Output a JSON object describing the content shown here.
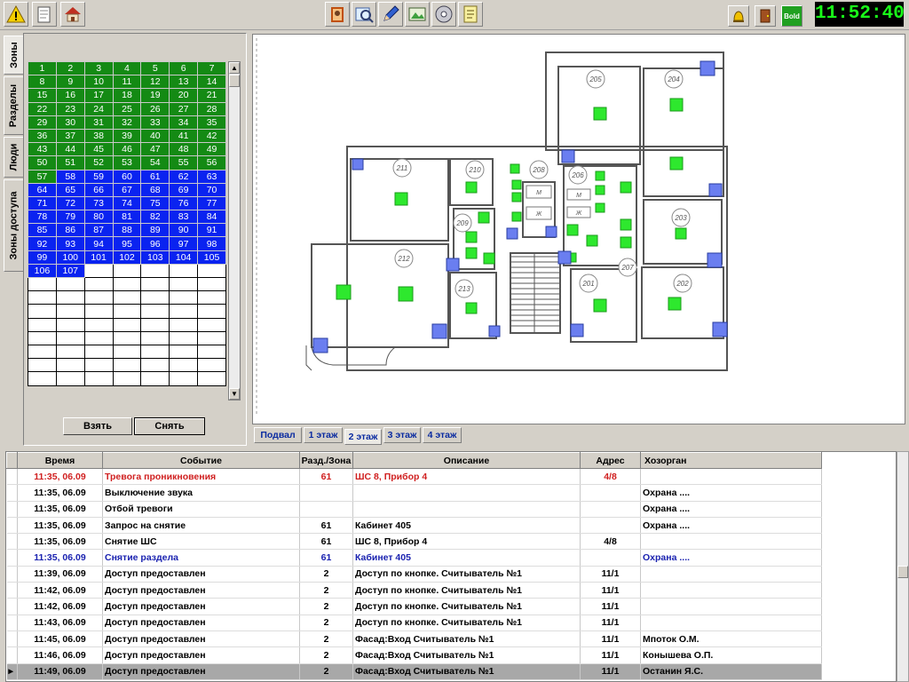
{
  "toolbar": {
    "clock": "11:52:40",
    "bold_label": "Bold",
    "icons_left": [
      "alarm-warning-icon",
      "journal-icon",
      "home-icon"
    ],
    "icons_center": [
      "operator-book-icon",
      "map-search-icon",
      "edit-pen-icon",
      "image-view-icon",
      "disk-icon",
      "report-list-icon"
    ],
    "icons_right": [
      "alarm-bell-icon",
      "exit-door-icon"
    ]
  },
  "side_tabs": [
    "Зоны",
    "Разделы",
    "Люди",
    "Зоны доступа"
  ],
  "zones": {
    "green_numbers": [
      1,
      2,
      3,
      4,
      5,
      6,
      7,
      8,
      9,
      10,
      11,
      12,
      13,
      14,
      15,
      16,
      17,
      18,
      19,
      20,
      21,
      22,
      23,
      24,
      25,
      26,
      27,
      28,
      29,
      30,
      31,
      32,
      33,
      34,
      35,
      36,
      37,
      38,
      39,
      40,
      41,
      42,
      43,
      44,
      45,
      46,
      47,
      48,
      49,
      50,
      51,
      52,
      53,
      54,
      55,
      56,
      57
    ],
    "blue_numbers": [
      58,
      59,
      60,
      61,
      62,
      63,
      64,
      65,
      66,
      67,
      68,
      69,
      70,
      71,
      72,
      73,
      74,
      75,
      76,
      77,
      78,
      79,
      80,
      81,
      82,
      83,
      84,
      85,
      86,
      87,
      88,
      89,
      90,
      91,
      92,
      93,
      94,
      95,
      96,
      97,
      98,
      99,
      100,
      101,
      102,
      103,
      104,
      105,
      106,
      107
    ],
    "empty_rows": 8,
    "take_button": "Взять",
    "remove_button": "Снять"
  },
  "plan": {
    "rooms": [
      "205",
      "204",
      "211",
      "210",
      "208",
      "206",
      "209",
      "203",
      "212",
      "213",
      "201",
      "207",
      "202"
    ],
    "wc_labels": [
      "М",
      "Ж",
      "М",
      "Ж"
    ],
    "colors": {
      "sensor": "#2ee82e",
      "reader": "#6a7ef0",
      "wall": "#555555"
    }
  },
  "floor_tabs": {
    "tabs": [
      "Подвал",
      "1 этаж",
      "2 этаж",
      "3 этаж",
      "4 этаж"
    ],
    "active_index": 2
  },
  "events": {
    "columns": [
      "Время",
      "Событие",
      "Разд./Зона",
      "Описание",
      "Адрес",
      "Хозорган"
    ],
    "rows": [
      {
        "time": "11:35, 06.09",
        "event": "Тревога проникновения",
        "zone": "61",
        "desc": "ШС 8, Прибор 4",
        "addr": "4/8",
        "owner": "",
        "style": "red"
      },
      {
        "time": "11:35, 06.09",
        "event": "Выключение звука",
        "zone": "",
        "desc": "",
        "addr": "",
        "owner": "Охрана ....",
        "style": "normal"
      },
      {
        "time": "11:35, 06.09",
        "event": "Отбой тревоги",
        "zone": "",
        "desc": "",
        "addr": "",
        "owner": "Охрана ....",
        "style": "normal"
      },
      {
        "time": "11:35, 06.09",
        "event": "Запрос на снятие",
        "zone": "61",
        "desc": "Кабинет 405",
        "addr": "",
        "owner": "Охрана ....",
        "style": "normal"
      },
      {
        "time": "11:35, 06.09",
        "event": "Снятие ШС",
        "zone": "61",
        "desc": "ШС 8, Прибор 4",
        "addr": "4/8",
        "owner": "",
        "style": "normal"
      },
      {
        "time": "11:35, 06.09",
        "event": "Снятие раздела",
        "zone": "61",
        "desc": "Кабинет 405",
        "addr": "",
        "owner": "Охрана ....",
        "style": "blue"
      },
      {
        "time": "11:39, 06.09",
        "event": "Доступ предоставлен",
        "zone": "2",
        "desc": "Доступ по кнопке. Считыватель №1",
        "addr": "11/1",
        "owner": "",
        "style": "normal"
      },
      {
        "time": "11:42, 06.09",
        "event": "Доступ предоставлен",
        "zone": "2",
        "desc": "Доступ по кнопке. Считыватель №1",
        "addr": "11/1",
        "owner": "",
        "style": "normal"
      },
      {
        "time": "11:42, 06.09",
        "event": "Доступ предоставлен",
        "zone": "2",
        "desc": "Доступ по кнопке. Считыватель №1",
        "addr": "11/1",
        "owner": "",
        "style": "normal"
      },
      {
        "time": "11:43, 06.09",
        "event": "Доступ предоставлен",
        "zone": "2",
        "desc": "Доступ по кнопке. Считыватель №1",
        "addr": "11/1",
        "owner": "",
        "style": "normal"
      },
      {
        "time": "11:45, 06.09",
        "event": "Доступ предоставлен",
        "zone": "2",
        "desc": "Фасад:Вход Считыватель №1",
        "addr": "11/1",
        "owner": "Мпоток О.М.",
        "style": "normal"
      },
      {
        "time": "11:46, 06.09",
        "event": "Доступ предоставлен",
        "zone": "2",
        "desc": "Фасад:Вход Считыватель №1",
        "addr": "11/1",
        "owner": "Конышева О.П.",
        "style": "normal"
      },
      {
        "time": "11:49, 06.09",
        "event": "Доступ предоставлен",
        "zone": "2",
        "desc": "Фасад:Вход Считыватель №1",
        "addr": "11/1",
        "owner": "Останин Я.С.",
        "style": "selected"
      }
    ]
  }
}
